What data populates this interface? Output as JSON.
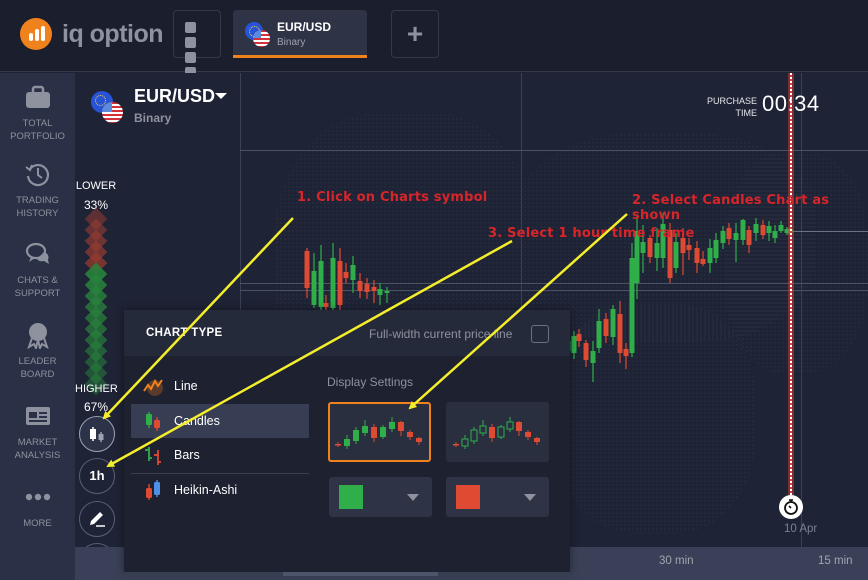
{
  "app": {
    "logo_text": "iq option",
    "brand_color": "#f0821e"
  },
  "topbar": {
    "grid_button_icon": "grid-icon",
    "active_tab": {
      "asset": "EUR/USD",
      "type": "Binary"
    },
    "add_tab_icon": "plus-icon"
  },
  "sidebar": {
    "items": [
      {
        "label_line1": "TOTAL",
        "label_line2": "PORTFOLIO",
        "icon": "briefcase-icon"
      },
      {
        "label_line1": "TRADING",
        "label_line2": "HISTORY",
        "icon": "history-icon"
      },
      {
        "label_line1": "CHATS &",
        "label_line2": "SUPPORT",
        "icon": "chat-icon"
      },
      {
        "label_line1": "LEADER",
        "label_line2": "BOARD",
        "icon": "medal-icon"
      },
      {
        "label_line1": "MARKET",
        "label_line2": "ANALYSIS",
        "icon": "newspaper-icon"
      },
      {
        "label_line1": "",
        "label_line2": "MORE",
        "icon": "more-dots-icon"
      }
    ]
  },
  "chart": {
    "asset": "EUR/USD",
    "asset_type": "Binary",
    "purchase_label_line1": "PURCHASE",
    "purchase_label_line2": "TIME",
    "purchase_time": "00:34",
    "expiry_date": "10 Apr",
    "time_axis": [
      "30 min",
      "15 min"
    ],
    "sentiment": {
      "lower_label": "LOWER",
      "lower_pct": "33%",
      "higher_label": "HIGHER",
      "higher_pct": "67%",
      "lower_fraction": 0.33,
      "higher_fraction": 0.67
    },
    "up_color": "#2fae4a",
    "down_color": "#de4a32",
    "tools": [
      {
        "name": "chart-type",
        "icon": "candles-icon"
      },
      {
        "name": "timeframe",
        "label": "1h"
      },
      {
        "name": "drawing",
        "icon": "pencil-icon"
      },
      {
        "name": "indicators",
        "icon": "indicator-wave-icon"
      }
    ]
  },
  "chart_type_panel": {
    "title": "CHART TYPE",
    "full_width_label": "Full-width current price line",
    "full_width_checked": false,
    "types": [
      {
        "label": "Line",
        "icon": "line-chart-icon",
        "selected": false
      },
      {
        "label": "Candles",
        "icon": "candles-icon",
        "selected": true
      },
      {
        "label": "Bars",
        "icon": "bars-icon",
        "selected": false
      },
      {
        "label": "Heikin-Ashi",
        "icon": "heikin-ashi-icon",
        "selected": false
      }
    ],
    "display_settings_label": "Display Settings",
    "styles": [
      {
        "name": "filled-candles",
        "selected": true
      },
      {
        "name": "hollow-candles",
        "selected": false
      }
    ],
    "up_color": "#2fae4a",
    "down_color": "#de4a32"
  },
  "annotations": [
    {
      "text": "1. Click on Charts symbol"
    },
    {
      "text": "2. Select Candles Chart as shown"
    },
    {
      "text": "3. Select 1 hour time frame"
    }
  ]
}
